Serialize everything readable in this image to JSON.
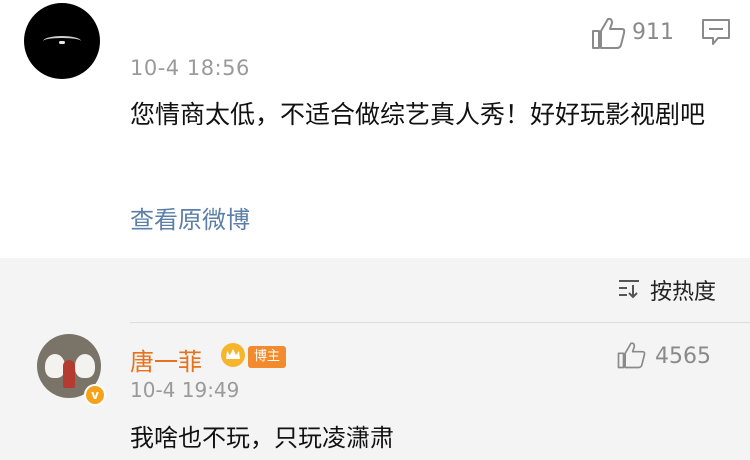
{
  "comment": {
    "likes": "911",
    "time": "10-4 18:56",
    "text": "您情商太低，不适合做综艺真人秀！好好玩影视剧吧",
    "view_original": "查看原微博"
  },
  "sort": {
    "label": "按热度"
  },
  "reply": {
    "name": "唐一菲",
    "tag": "博主",
    "likes": "4565",
    "time": "10-4 19:49",
    "text": "我啥也不玩，只玩凌潇肃"
  },
  "colors": {
    "link": "#5c7fa8",
    "name": "#e8711c",
    "tag": "#f28a2e",
    "band": "#f4f4f4"
  }
}
